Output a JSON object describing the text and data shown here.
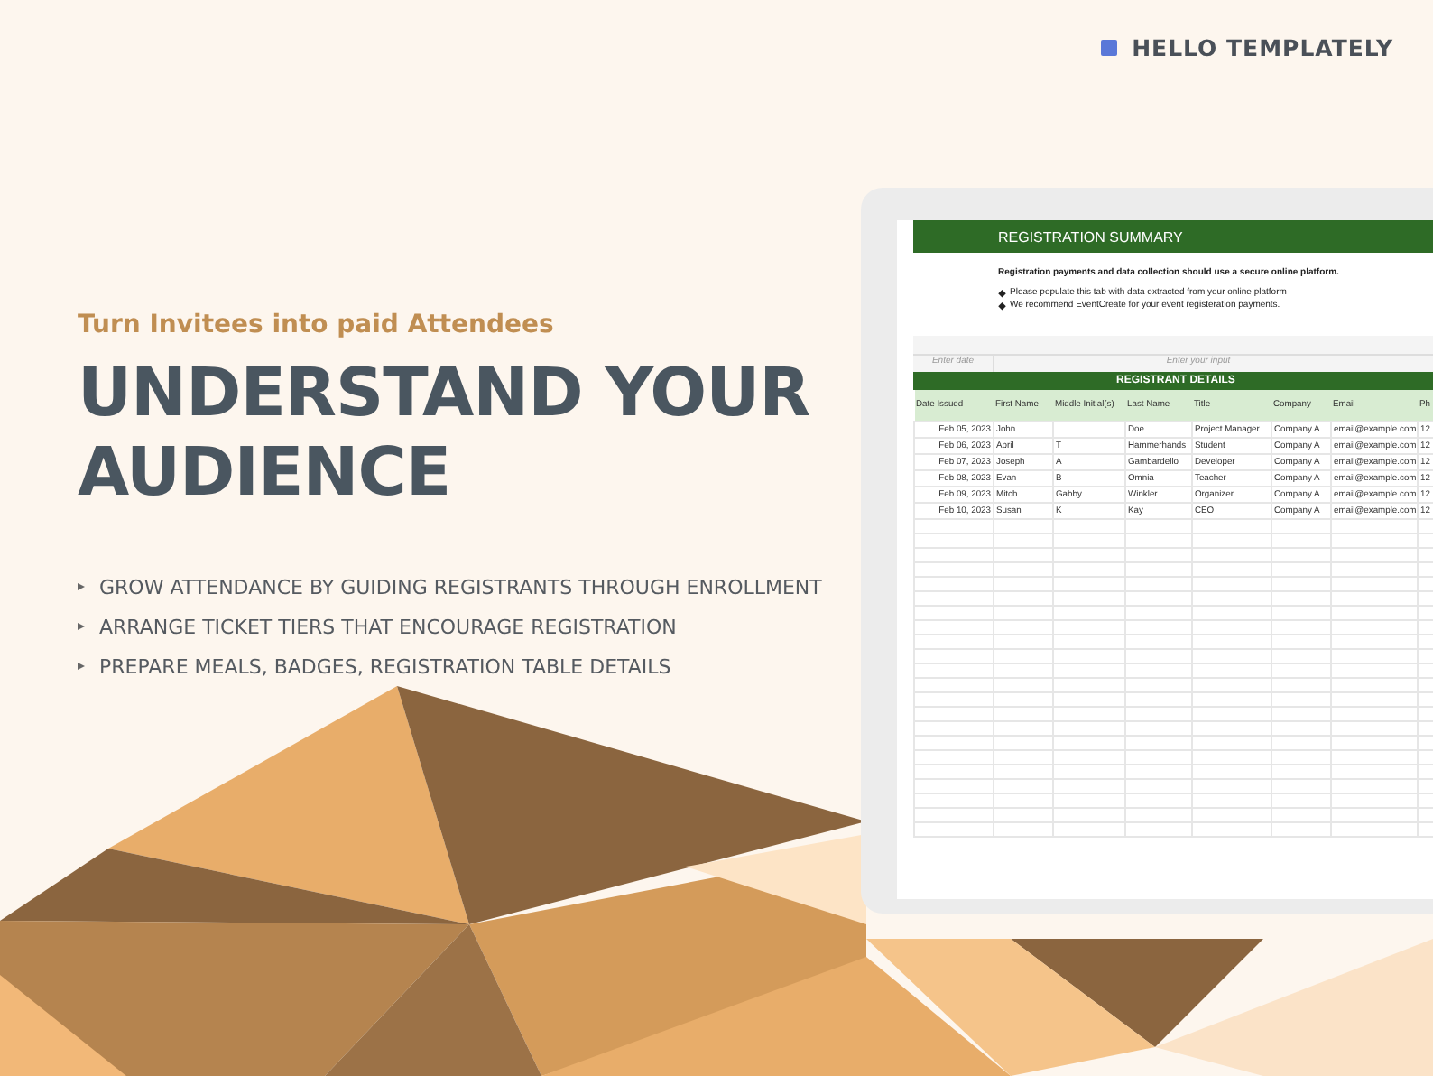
{
  "brand": {
    "name": "HELLO TEMPLATELY"
  },
  "hero": {
    "eyebrow": "Turn Invitees into paid Attendees",
    "heading": "UNDERSTAND YOUR AUDIENCE",
    "bullets": [
      "GROW ATTENDANCE BY GUIDING REGISTRANTS THROUGH ENROLLMENT",
      "ARRANGE TICKET TIERS THAT ENCOURAGE REGISTRATION",
      "PREPARE MEALS, BADGES, REGISTRATION TABLE DETAILS"
    ]
  },
  "spreadsheet": {
    "title": "REGISTRATION SUMMARY",
    "note": "Registration payments and data collection should use a secure online platform.",
    "tips": [
      "Please  populate this tab with data extracted from your online platform",
      "We recommend EventCreate for your event registeration payments."
    ],
    "input_row": {
      "date_prompt": "Enter date",
      "input_prompt": "Enter your input"
    },
    "table": {
      "title": "REGISTRANT DETAILS",
      "columns": [
        "Date Issued",
        "First Name",
        "Middle Initial(s)",
        "Last Name",
        "Title",
        "Company",
        "Email",
        "Ph"
      ],
      "rows": [
        [
          "Feb 05, 2023",
          "John",
          null,
          "Doe",
          "Project Manager",
          "Company A",
          "email@example.com",
          "12"
        ],
        [
          "Feb 06, 2023",
          "April",
          "T",
          "Hammerhands",
          "Student",
          "Company A",
          "email@example.com",
          "12"
        ],
        [
          "Feb 07, 2023",
          "Joseph",
          "A",
          "Gambardello",
          "Developer",
          "Company A",
          "email@example.com",
          "12"
        ],
        [
          "Feb 08, 2023",
          "Evan",
          "B",
          "Omnia",
          "Teacher",
          "Company A",
          "email@example.com",
          "12"
        ],
        [
          "Feb 09, 2023",
          "Mitch",
          "Gabby",
          "Winkler",
          "Organizer",
          "Company A",
          "email@example.com",
          "12"
        ],
        [
          "Feb 10, 2023",
          "Susan",
          "K",
          "Kay",
          "CEO",
          "Company A",
          "email@example.com",
          "12"
        ]
      ]
    }
  }
}
